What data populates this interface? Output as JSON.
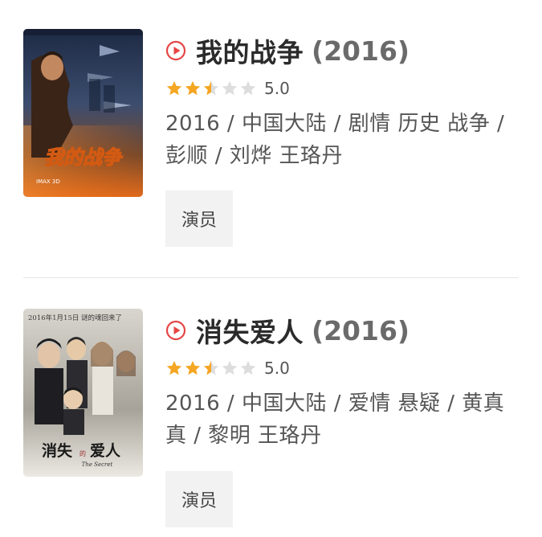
{
  "colors": {
    "accent": "#e64545",
    "star_filled": "#f5a623",
    "star_empty": "#dddddd"
  },
  "movies": [
    {
      "title": "我的战争",
      "year": "(2016)",
      "rating": "5.0",
      "stars_filled": 2.5,
      "meta": "2016 / 中国大陆 / 剧情 历史 战争 / 彭顺 / 刘烨 王珞丹",
      "cast_label": "演员",
      "poster_text": "我的战争"
    },
    {
      "title": "消失爱人",
      "year": "(2016)",
      "rating": "5.0",
      "stars_filled": 2.5,
      "meta": "2016 / 中国大陆 / 爱情 悬疑 / 黄真真 / 黎明 王珞丹",
      "cast_label": "演员",
      "poster_text": "消失爱人",
      "poster_subtitle": "The Secret",
      "poster_banner": "2016年1月15日 谜的魂回来了"
    }
  ]
}
